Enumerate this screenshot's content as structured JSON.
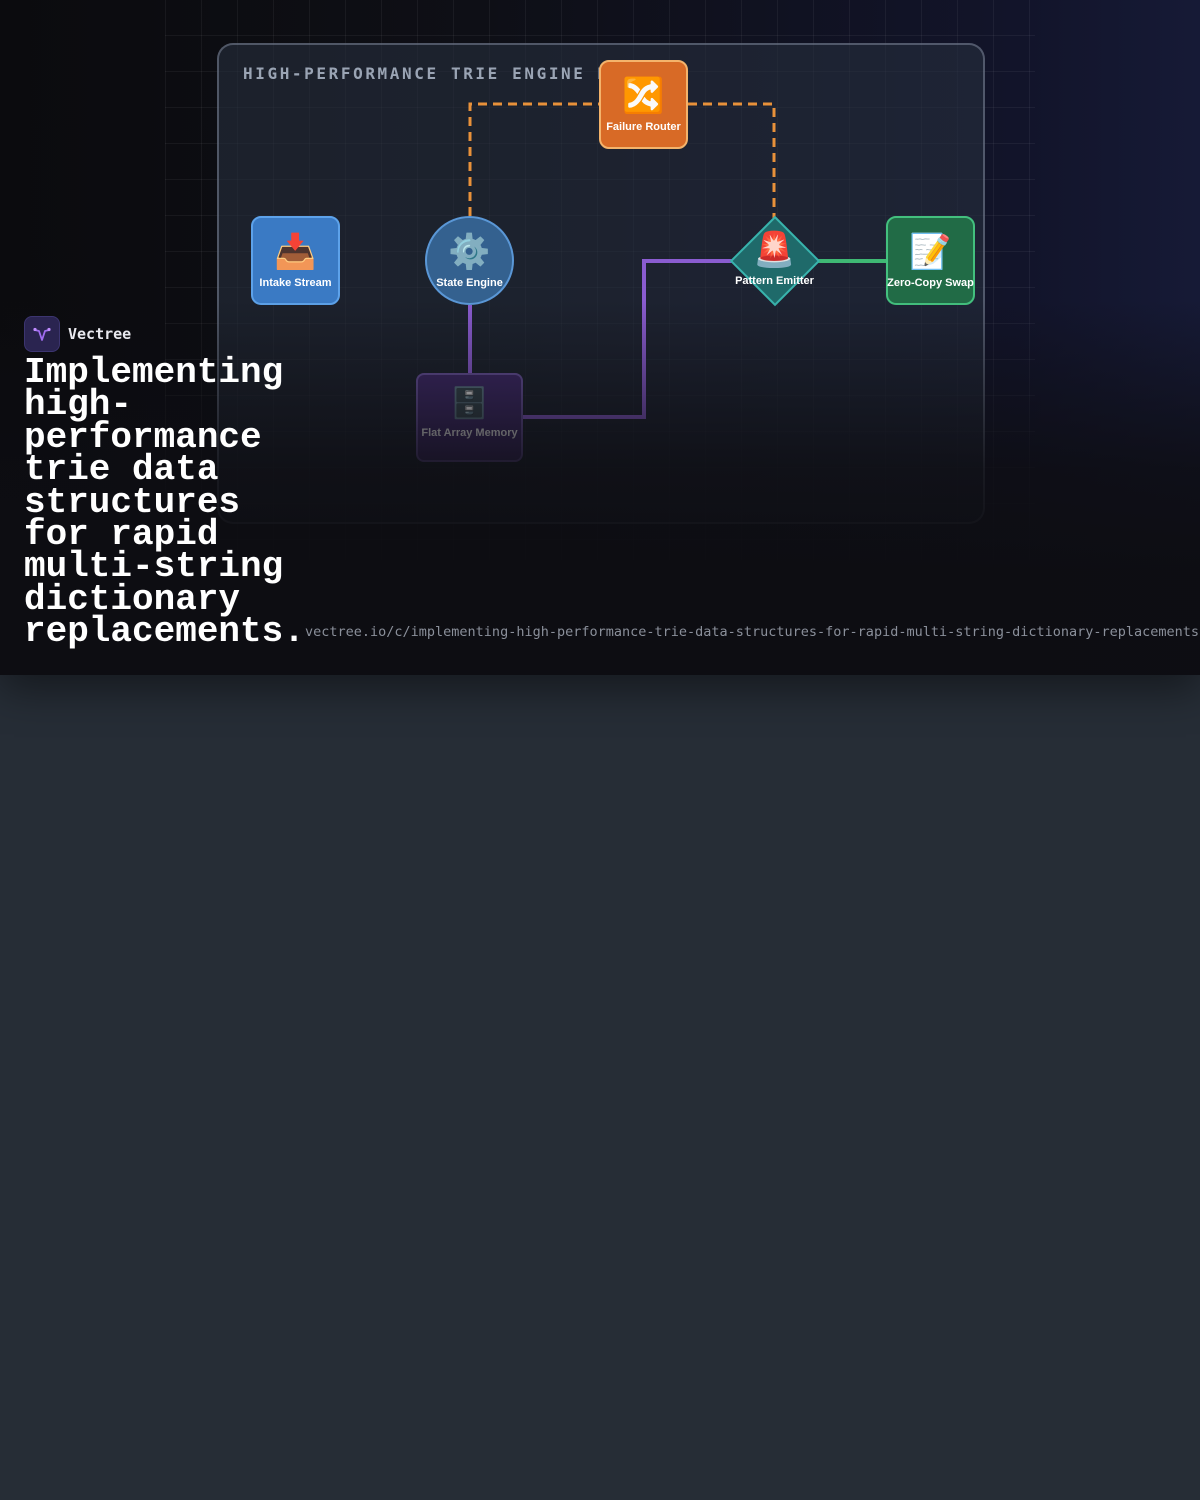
{
  "brand": {
    "name": "Vectree"
  },
  "headline": "Implementing high-performance trie data structures for rapid multi-string dictionary replacements.",
  "url": "vectree.io/c/implementing-high-performance-trie-data-structures-for-rapid-multi-string-dictionary-replacements",
  "diagram": {
    "title": "HIGH-PERFORMANCE TRIE ENGINE MK-",
    "nodes": {
      "intake": {
        "label": "Intake Stream",
        "icon": "inbox-tray-icon"
      },
      "state": {
        "label": "State Engine",
        "icon": "gear-icon"
      },
      "failure": {
        "label": "Failure Router",
        "icon": "shuffle-icon"
      },
      "pattern": {
        "label": "Pattern Emitter",
        "icon": "rotating-light-icon"
      },
      "zero": {
        "label": "Zero-Copy Swap",
        "icon": "memo-icon"
      },
      "flat": {
        "label": "Flat Array Memory",
        "icon": "file-cabinet-icon"
      }
    },
    "edges": [
      {
        "from": "state",
        "to": "failure",
        "style": "dashed",
        "color": "#e8913a"
      },
      {
        "from": "failure",
        "to": "pattern",
        "style": "dashed",
        "color": "#e8913a"
      },
      {
        "from": "state",
        "to": "flat",
        "style": "solid",
        "color": "#8a5cd0"
      },
      {
        "from": "flat",
        "to": "pattern",
        "style": "solid",
        "color": "#8a5cd0"
      },
      {
        "from": "pattern",
        "to": "zero",
        "style": "solid",
        "color": "#3fb874"
      }
    ]
  }
}
